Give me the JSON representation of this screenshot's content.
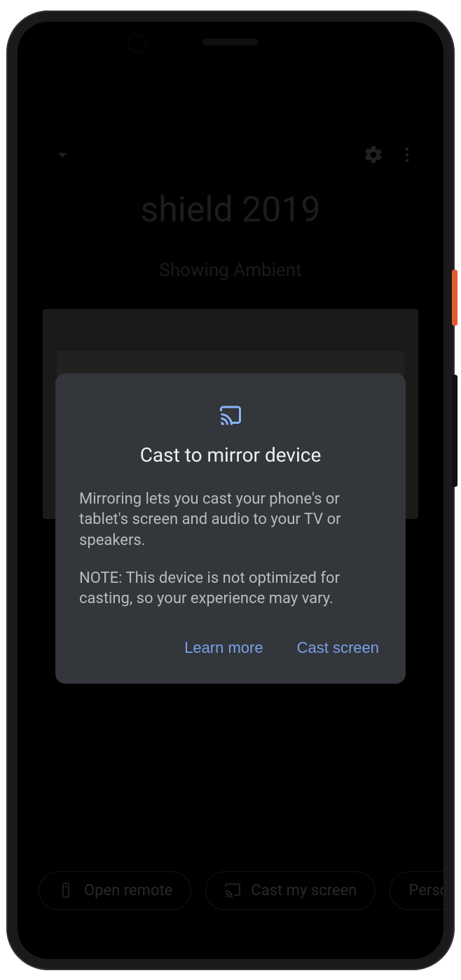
{
  "header": {
    "collapse_icon": "chevron-down",
    "settings_icon": "gear",
    "more_icon": "more-vert"
  },
  "device": {
    "title": "shield 2019",
    "subtitle": "Showing Ambient"
  },
  "dialog": {
    "icon": "cast",
    "title": "Cast to mirror device",
    "body1": "Mirroring lets you cast your phone's or tablet's screen and audio to your TV or speakers.",
    "body2": "NOTE: This device is not optimized for casting, so your experience may vary.",
    "learn_more": "Learn more",
    "cast_screen": "Cast screen"
  },
  "chips": {
    "open_remote": "Open remote",
    "cast_my_screen": "Cast my screen",
    "personal": "Personal"
  }
}
